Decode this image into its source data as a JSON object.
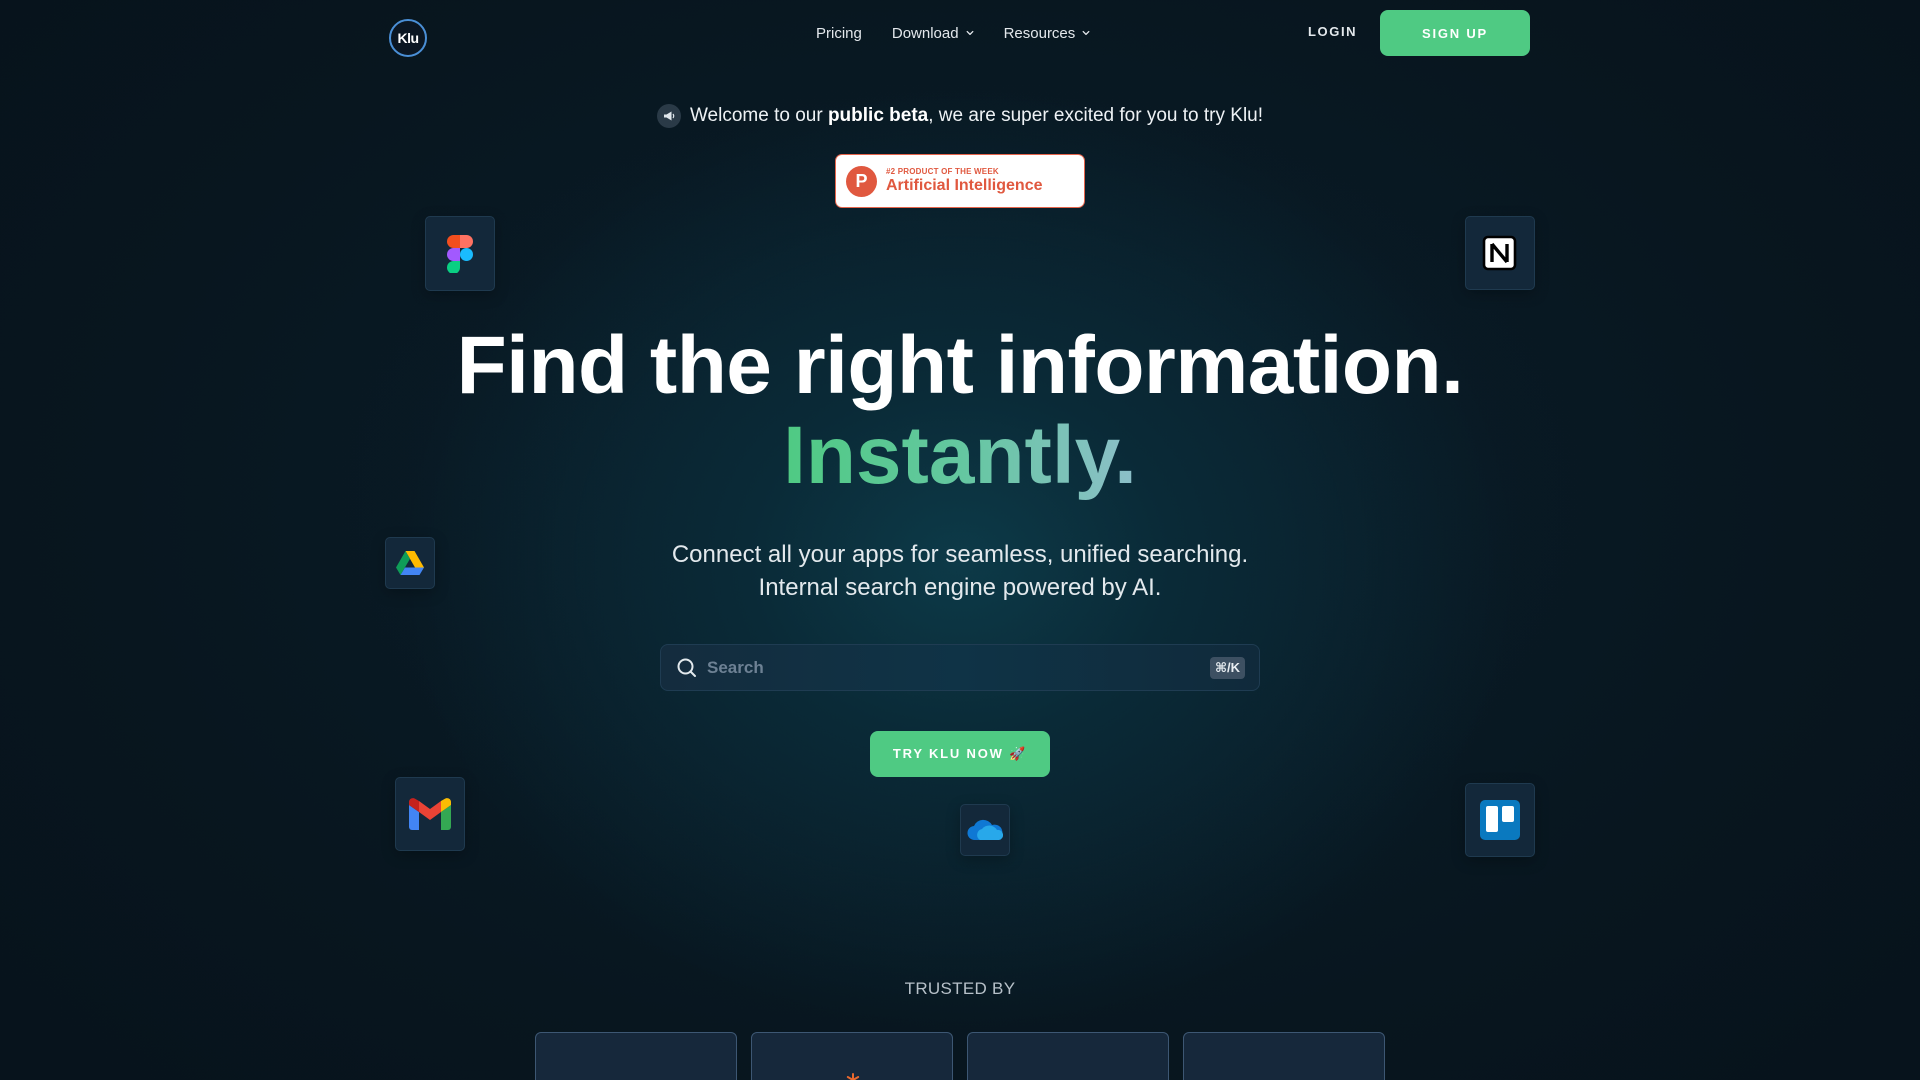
{
  "nav": {
    "logo_text": "Klu",
    "links": [
      {
        "label": "Pricing"
      },
      {
        "label": "Download"
      },
      {
        "label": "Resources"
      }
    ],
    "login_label": "LOGIN",
    "signup_label": "SIGN UP"
  },
  "banner": {
    "text_before": "Welcome to our ",
    "text_bold": "public beta",
    "text_after": ", we are super excited for you to try Klu!"
  },
  "product_hunt": {
    "letter": "P",
    "small": "#2 PRODUCT OF THE WEEK",
    "big": "Artificial Intelligence"
  },
  "apps": [
    "figma-icon",
    "notion-icon",
    "google-drive-icon",
    "gmail-icon",
    "onedrive-icon",
    "trello-icon"
  ],
  "hero": {
    "title": "Find the right information.",
    "highlight": "Instantly.",
    "subtitle_line1": "Connect all your apps for seamless, unified searching.",
    "subtitle_line2": "Internal search engine powered by AI."
  },
  "search": {
    "placeholder": "Search",
    "shortcut": "⌘/K"
  },
  "cta": {
    "label": "TRY KLU NOW 🚀"
  },
  "trusted": {
    "label": "TRUSTED BY"
  },
  "colors": {
    "accent": "#4fca83",
    "background": "#08161f",
    "product_hunt": "#e0583f"
  }
}
